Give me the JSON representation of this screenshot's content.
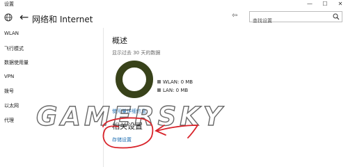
{
  "window": {
    "title": "设置",
    "controls": {
      "minimize": "—",
      "maximize": "☐",
      "close": "✕"
    }
  },
  "header": {
    "back_icon": "←",
    "page_title": "网络和 Internet",
    "pin_icon": "⇦",
    "search_placeholder": "查找设置"
  },
  "sidebar": {
    "items": [
      {
        "label": "WLAN"
      },
      {
        "label": "飞行模式"
      },
      {
        "label": "数据使用量"
      },
      {
        "label": "VPN"
      },
      {
        "label": "拨号"
      },
      {
        "label": "以太网"
      },
      {
        "label": "代理"
      }
    ]
  },
  "main": {
    "heading": "概述",
    "subtitle": "显示过去 30 天的数据",
    "legend": [
      {
        "label": "WLAN: 0 MB"
      },
      {
        "label": "LAN: 0 MB"
      }
    ],
    "usage_link": "使用量详细信息",
    "related_heading": "相关设置",
    "storage_link": "存储设置"
  },
  "watermark": "GAMERSKY",
  "colors": {
    "donut": "#38421a",
    "link": "#1f6fb2",
    "annotation": "#d8232a"
  }
}
